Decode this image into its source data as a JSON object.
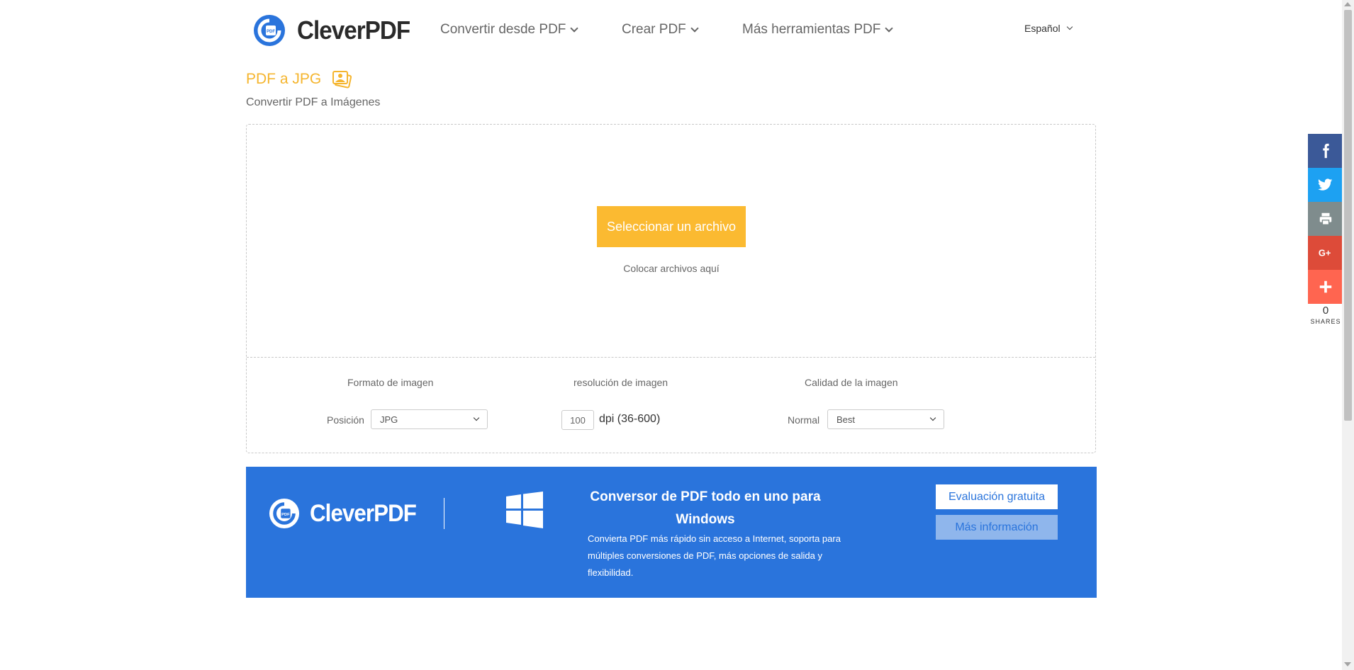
{
  "brand": {
    "name": "CleverPDF",
    "badge_text": "PDF",
    "color": "#2a74dc"
  },
  "nav": {
    "items": [
      {
        "label": "Convertir desde PDF"
      },
      {
        "label": "Crear PDF"
      },
      {
        "label": "Más herramientas PDF"
      }
    ],
    "language": "Español"
  },
  "page": {
    "title": "PDF a JPG",
    "subtitle": "Convertir PDF a Imágenes",
    "title_color": "#f5b52e"
  },
  "upload": {
    "button_label": "Seleccionar un archivo",
    "drop_hint": "Colocar archivos aquí",
    "button_color": "#fbba31"
  },
  "options": {
    "format": {
      "heading": "Formato de imagen",
      "label": "Posición",
      "value": "JPG"
    },
    "resolution": {
      "heading": "resolución de imagen",
      "value": "100",
      "unit": "dpi (36-600)"
    },
    "quality": {
      "heading": "Calidad de la imagen",
      "label": "Normal",
      "value": "Best"
    }
  },
  "promo": {
    "heading": "Conversor de PDF todo en uno para Windows",
    "text": "Convierta PDF más rápido sin acceso a Internet, soporta para múltiples conversiones de PDF, más opciones de salida y flexibilidad.",
    "trial_label": "Evaluación gratuita",
    "info_label": "Más información",
    "bg_color": "#2a74dc"
  },
  "share": {
    "count": "0",
    "label": "SHARES",
    "buttons": [
      {
        "name": "facebook",
        "color": "#3b5998"
      },
      {
        "name": "twitter",
        "color": "#1da1f2"
      },
      {
        "name": "print",
        "color": "#7f8c8d"
      },
      {
        "name": "google-plus",
        "color": "#dd4b39"
      },
      {
        "name": "more",
        "color": "#ff6550"
      }
    ]
  }
}
